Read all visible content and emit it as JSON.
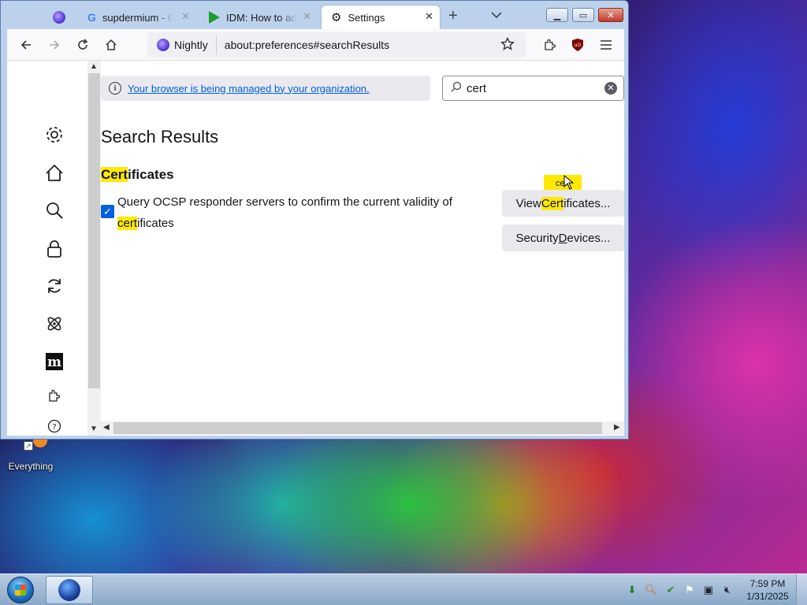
{
  "tabs": [
    {
      "title": "",
      "icon": "nightly-icon",
      "active": false
    },
    {
      "title": "supdermium - G",
      "icon": "google-icon",
      "active": false
    },
    {
      "title": "IDM: How to ad",
      "icon": "idm-icon",
      "active": false
    },
    {
      "title": "Settings",
      "icon": "gear-icon",
      "active": true
    }
  ],
  "nav": {
    "identity_label": "Nightly",
    "url": "about:preferences#searchResults"
  },
  "managed": {
    "link_text": "Your browser is being managed by your organization."
  },
  "search": {
    "value": "cert"
  },
  "results": {
    "heading": "Search Results",
    "section": {
      "highlight": "Cert",
      "rest": "ificates"
    },
    "checkbox_checked": true,
    "desc_prefix": "Query OCSP responder servers to confirm the current validity of ",
    "desc_highlight": "cert",
    "desc_suffix": "ificates",
    "view_button": {
      "pre": "View ",
      "highlight": "Cert",
      "post": "ificates..."
    },
    "security_button": {
      "pre": "Security ",
      "underline": "D",
      "post": "evices..."
    },
    "tooltip": "cert"
  },
  "desktop": {
    "icon_label": "Everything"
  },
  "taskbar": {
    "time": "7:59 PM",
    "date": "1/31/2025"
  }
}
